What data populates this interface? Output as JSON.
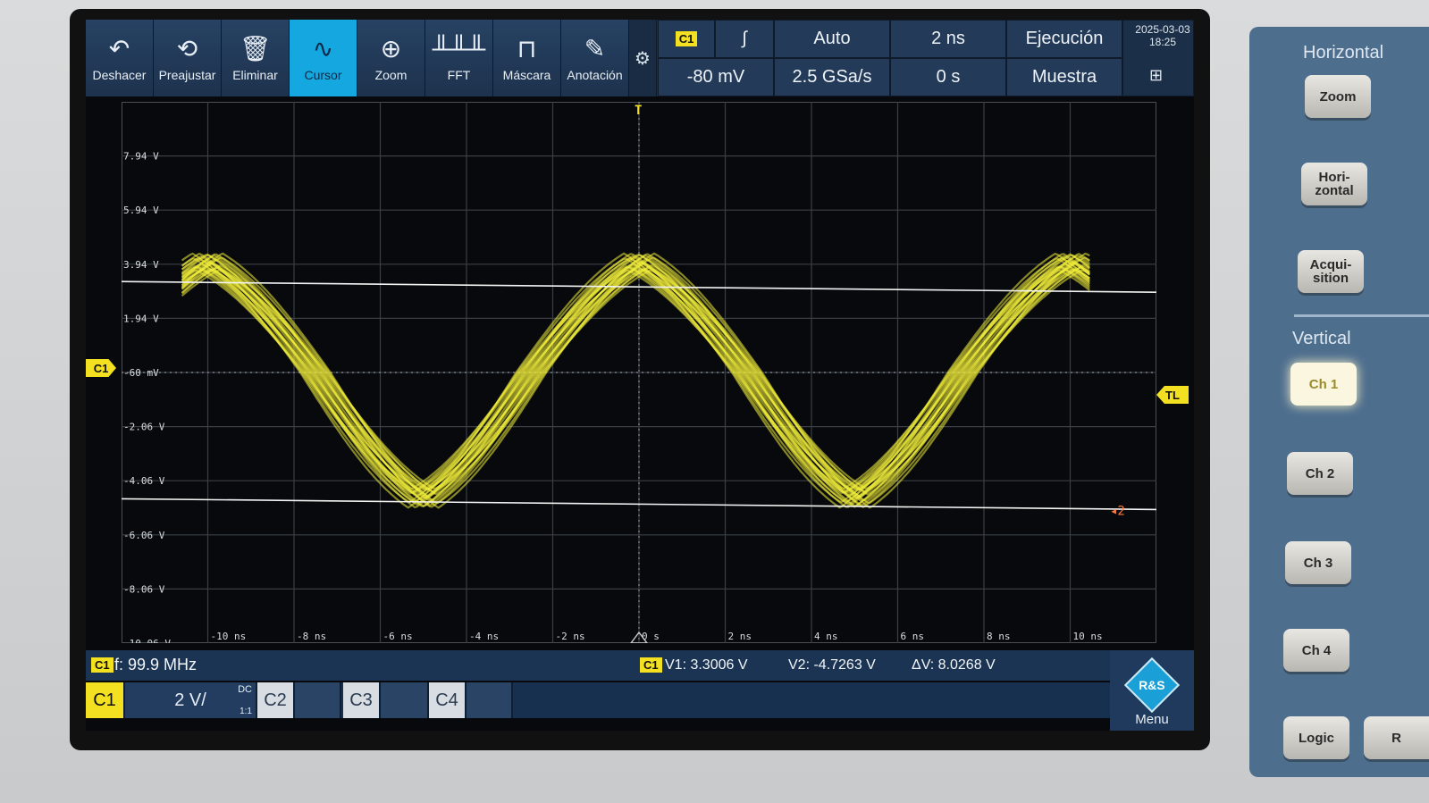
{
  "toolbar": {
    "items": [
      {
        "label": "Deshacer",
        "icon": "↶",
        "icon_name": "undo-icon"
      },
      {
        "label": "Preajustar",
        "icon": "⟲",
        "icon_name": "preset-icon"
      },
      {
        "label": "Eliminar",
        "icon": "🗑",
        "icon_name": "trash-icon"
      },
      {
        "label": "Cursor",
        "icon": "∿",
        "icon_name": "cursor-wave-icon"
      },
      {
        "label": "Zoom",
        "icon": "⊕",
        "icon_name": "zoom-icon"
      },
      {
        "label": "FFT",
        "icon": "╨╨╨",
        "icon_name": "fft-icon"
      },
      {
        "label": "Máscara",
        "icon": "⊓",
        "icon_name": "mask-icon"
      },
      {
        "label": "Anotación",
        "icon": "✎",
        "icon_name": "pencil-icon"
      }
    ],
    "active_index": 3
  },
  "settings": {
    "channel_tag": "C1",
    "trigger_slope": "∫",
    "trigger_mode": "Auto",
    "timebase": "2 ns",
    "run_state": "Ejecución",
    "trigger_level": "-80 mV",
    "sample_rate": "2.5 GSa/s",
    "position": "0 s",
    "acq_mode": "Muestra",
    "date": "2025-03-03",
    "time": "18:25"
  },
  "grid": {
    "y_labels": [
      "7.94 V",
      "5.94 V",
      "3.94 V",
      "1.94 V",
      "-60 mV",
      "-2.06 V",
      "-4.06 V",
      "-6.06 V",
      "-8.06 V",
      "-10.06 V"
    ],
    "x_labels": [
      "-10 ns",
      "-8 ns",
      "-6 ns",
      "-4 ns",
      "-2 ns",
      "0 s",
      "2 ns",
      "4 ns",
      "6 ns",
      "8 ns",
      "10 ns"
    ],
    "c1_marker": "C1",
    "tl_marker": "TL",
    "cursor2_label": "2",
    "trigger_marker": "T"
  },
  "status": {
    "freq_tag": "C1",
    "frequency": "f: 99.9 MHz",
    "cursor_tag": "C1",
    "v1": "V1: 3.3006 V",
    "v2": "V2: -4.7263 V",
    "dv": "ΔV: 8.0268 V"
  },
  "channels": {
    "c1_label": "C1",
    "c1_scale": "2 V/",
    "c1_coupling": "DC",
    "c1_ratio": "1:1",
    "c2_label": "C2",
    "c3_label": "C3",
    "c4_label": "C4",
    "menu_label": "Menu",
    "logo_text": "R&S"
  },
  "panel": {
    "horizontal_title": "Horizontal",
    "vertical_title": "Vertical",
    "zoom": "Zoom",
    "horizontal": "Hori-\nzontal",
    "acquisition": "Acqui-\nsition",
    "ch1": "Ch 1",
    "ch2": "Ch 2",
    "ch3": "Ch 3",
    "ch4": "Ch 4",
    "logic": "Logic",
    "r_partial": "R"
  },
  "chart_data": {
    "type": "line",
    "xlabel": "",
    "ylabel": "",
    "xlim": [
      -12,
      12
    ],
    "ylim": [
      -10.06,
      9.94
    ],
    "x_ticks": [
      -10,
      -8,
      -6,
      -4,
      -2,
      0,
      2,
      4,
      6,
      8,
      10
    ],
    "y_ticks": [
      7.94,
      5.94,
      3.94,
      1.94,
      -0.06,
      -2.06,
      -4.06,
      -6.06,
      -8.06,
      -10.06
    ],
    "frequency_mhz": 99.9,
    "period_ns": 10.01,
    "amplitude_upper_v": 4.4,
    "amplitude_lower_v": -5.0,
    "cursor_v1": 3.3006,
    "cursor_v2": -4.7263,
    "trace_color": "#f2ee3a",
    "grid_color": "#3a3f46"
  }
}
